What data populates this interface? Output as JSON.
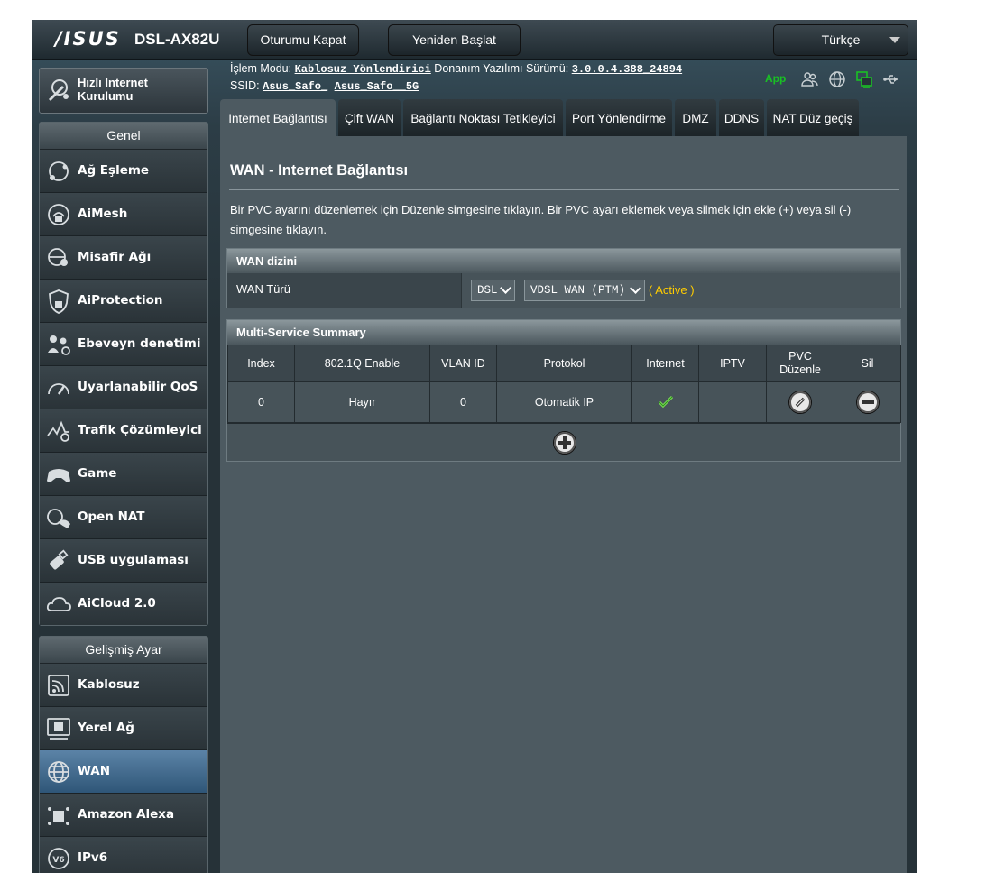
{
  "header": {
    "logo": "/ISUS",
    "model": "DSL-AX82U",
    "logout_label": "Oturumu Kapat",
    "reboot_label": "Yeniden Başlat",
    "language": "Türkçe"
  },
  "info": {
    "mode_label": "İşlem Modu:",
    "mode_value": "Kablosuz Yönlendirici",
    "firmware_label": "Donanım Yazılımı Sürümü:",
    "firmware_value": "3.0.0.4.388_24894",
    "ssid_label": "SSID:",
    "ssid_1": "Asus_Safo_",
    "ssid_2": "Asus_Safo__5G",
    "app_label": "App"
  },
  "quick_setup": {
    "label": "Hızlı Internet Kurulumu"
  },
  "general": {
    "title": "Genel",
    "items": [
      {
        "label": "Ağ Eşleme",
        "icon": "network-map-icon"
      },
      {
        "label": "AiMesh",
        "icon": "aimesh-icon"
      },
      {
        "label": "Misafir Ağı",
        "icon": "guest-network-icon"
      },
      {
        "label": "AiProtection",
        "icon": "shield-lock-icon"
      },
      {
        "label": "Ebeveyn denetimi",
        "icon": "parental-control-icon"
      },
      {
        "label": "Uyarlanabilir QoS",
        "icon": "speedometer-icon"
      },
      {
        "label": "Trafik Çözümleyici",
        "icon": "traffic-analyzer-icon"
      },
      {
        "label": "Game",
        "icon": "gamepad-icon"
      },
      {
        "label": "Open NAT",
        "icon": "open-nat-icon"
      },
      {
        "label": "USB uygulaması",
        "icon": "usb-icon"
      },
      {
        "label": "AiCloud 2.0",
        "icon": "cloud-icon"
      }
    ]
  },
  "advanced": {
    "title": "Gelişmiş Ayar",
    "items": [
      {
        "label": "Kablosuz",
        "icon": "wireless-icon"
      },
      {
        "label": "Yerel Ağ",
        "icon": "lan-icon"
      },
      {
        "label": "WAN",
        "icon": "globe-icon"
      },
      {
        "label": "Amazon Alexa",
        "icon": "alexa-icon"
      },
      {
        "label": "IPv6",
        "icon": "ipv6-icon"
      }
    ]
  },
  "tabs": [
    "Internet Bağlantısı",
    "Çift WAN",
    "Bağlantı Noktası Tetikleyici",
    "Port Yönlendirme",
    "DMZ",
    "DDNS",
    "NAT Düz geçiş"
  ],
  "page": {
    "title": "WAN - Internet Bağlantısı",
    "description": "Bir PVC ayarını düzenlemek için Düzenle simgesine tıklayın. Bir PVC ayarı eklemek veya silmek için ekle (+) veya sil (-) simgesine tıklayın."
  },
  "wan_index": {
    "title": "WAN dizini",
    "type_label": "WAN Türü",
    "type_value": "DSL",
    "mode_value": "VDSL WAN (PTM)",
    "status": "( Active )"
  },
  "summary": {
    "title": "Multi-Service Summary",
    "columns": [
      "Index",
      "802.1Q Enable",
      "VLAN ID",
      "Protokol",
      "Internet",
      "IPTV",
      "PVC Düzenle",
      "Sil"
    ],
    "rows": [
      {
        "index": "0",
        "enable": "Hayır",
        "vlan": "0",
        "protocol": "Otomatik IP",
        "internet": "check-icon",
        "iptv": ""
      }
    ]
  },
  "colors": {
    "accent_active": "#ffcc00",
    "app_green": "#19c024",
    "active_menu": "#4a729a"
  }
}
